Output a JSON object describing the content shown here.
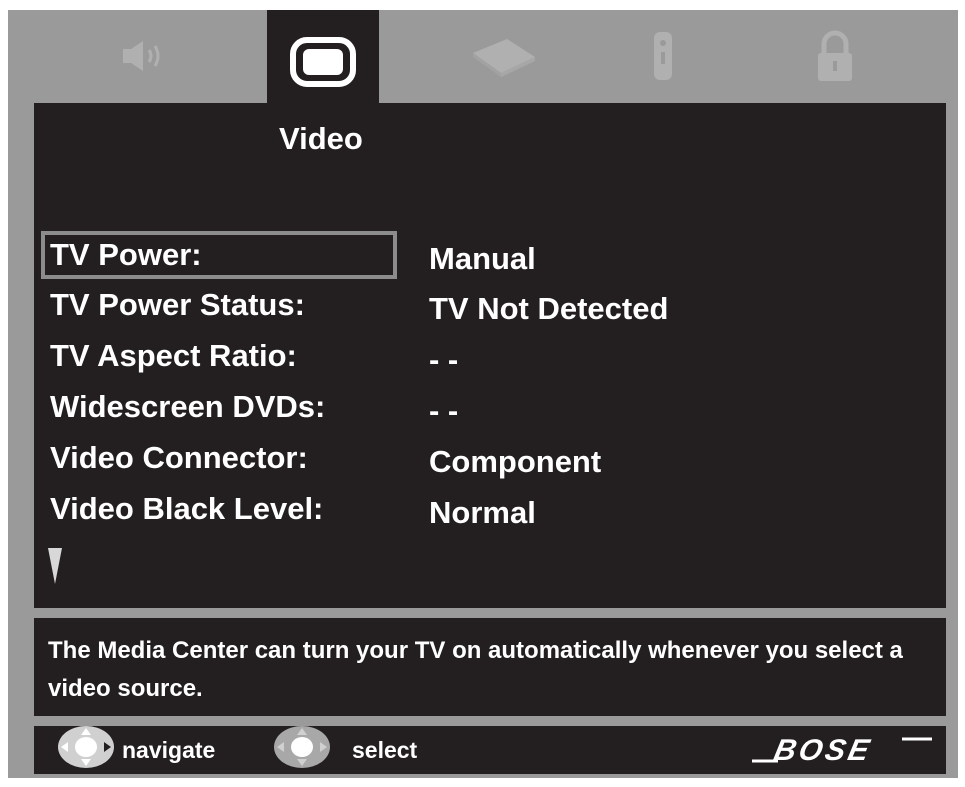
{
  "tabs": [
    {
      "id": "audio",
      "icon": "speaker-icon",
      "active": false
    },
    {
      "id": "video",
      "icon": "tv-icon",
      "active": true
    },
    {
      "id": "sources",
      "icon": "dvd-player-icon",
      "active": false
    },
    {
      "id": "remote",
      "icon": "remote-icon",
      "active": false
    },
    {
      "id": "lock",
      "icon": "lock-icon",
      "active": false
    }
  ],
  "page": {
    "title": "Video"
  },
  "settings": [
    {
      "label": "TV Power:",
      "value": "Manual",
      "selected": true
    },
    {
      "label": "TV Power Status:",
      "value": "TV Not Detected",
      "selected": false
    },
    {
      "label": "TV Aspect Ratio:",
      "value": "- -",
      "selected": false
    },
    {
      "label": "Widescreen DVDs:",
      "value": "- -",
      "selected": false
    },
    {
      "label": "Video Connector:",
      "value": "Component",
      "selected": false
    },
    {
      "label": "Video Black Level:",
      "value": "Normal",
      "selected": false
    }
  ],
  "description": "The Media Center can turn your TV on automatically whenever you select a video source.",
  "footer": {
    "navigate_label": "navigate",
    "select_label": "select",
    "brand": "BOSE"
  },
  "colors": {
    "frame": "#9a9a9a",
    "panel": "#231f20",
    "text": "#ffffff",
    "inactive_icon": "#b0b0b0",
    "selection_border": "#8c8c8c"
  }
}
